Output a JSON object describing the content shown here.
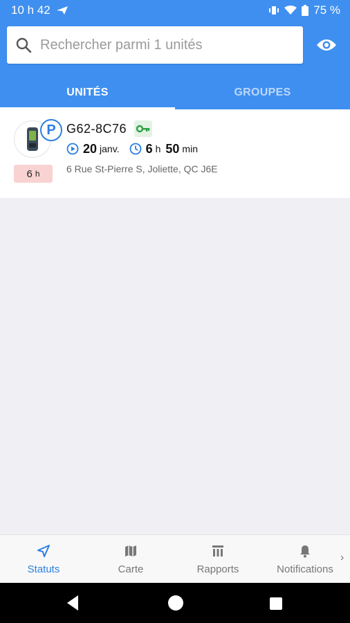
{
  "status_bar": {
    "time": "10 h 42",
    "battery": "75 %"
  },
  "search": {
    "placeholder": "Rechercher parmi 1 unités"
  },
  "tabs": [
    {
      "label": "UNITÉS",
      "active": true
    },
    {
      "label": "GROUPES",
      "active": false
    }
  ],
  "unit": {
    "name": "G62-8C76",
    "status_letter": "P",
    "duration_value": "6",
    "duration_unit": "h",
    "date_day": "20",
    "date_month": "janv.",
    "time_hours": "6",
    "time_hours_unit": "h",
    "time_minutes": "50",
    "time_minutes_unit": "min",
    "address": "6 Rue St-Pierre S, Joliette, QC J6E"
  },
  "bottom_nav": [
    {
      "label": "Statuts",
      "icon": "navigation-arrow-icon",
      "active": true
    },
    {
      "label": "Carte",
      "icon": "map-icon",
      "active": false
    },
    {
      "label": "Rapports",
      "icon": "reports-icon",
      "active": false
    },
    {
      "label": "Notifications",
      "icon": "bell-icon",
      "active": false
    }
  ],
  "colors": {
    "primary": "#3f8ff0",
    "accent": "#2b7fe0",
    "duration_badge_bg": "#f9d2d2",
    "key_badge_bg": "#e3f3e3",
    "key_green": "#2e9e44",
    "screen_bg": "#efeff4"
  }
}
